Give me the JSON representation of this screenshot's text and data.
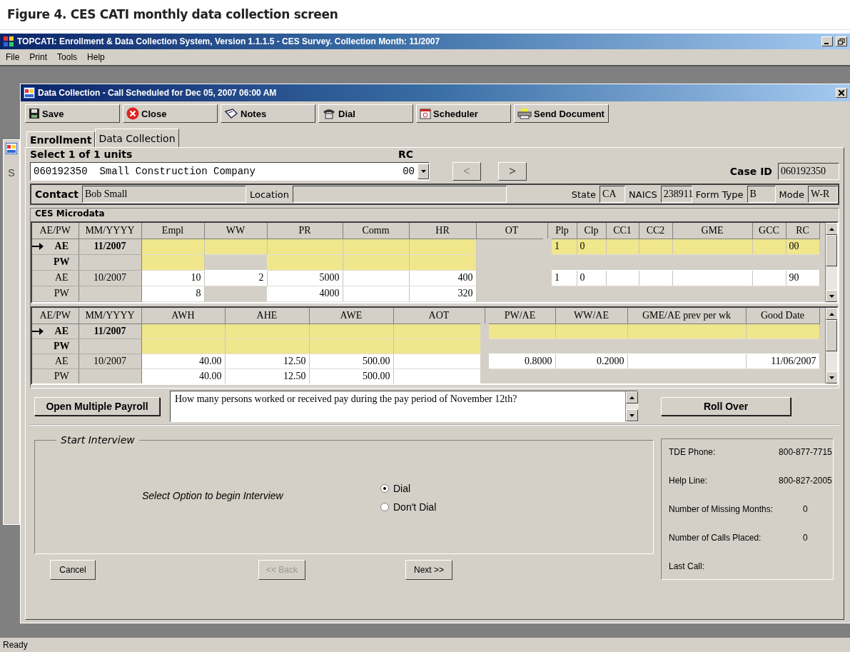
{
  "caption": "Figure 4. CES CATI monthly data collection screen",
  "window": {
    "title": "TOPCATI: Enrollment & Data Collection System, Version 1.1.1.5 - CES Survey. Collection Month: 11/2007"
  },
  "menu": [
    "File",
    "Print",
    "Tools",
    "Help"
  ],
  "background_window": {
    "label": "S"
  },
  "dialog": {
    "title": "Data Collection - Call Scheduled for Dec 05, 2007 06:00 AM"
  },
  "toolbar": [
    {
      "label": "Save",
      "kind": "save"
    },
    {
      "label": "Close",
      "kind": "close"
    },
    {
      "label": "Notes",
      "kind": "notes"
    },
    {
      "label": "Dial",
      "kind": "dial"
    },
    {
      "label": "Scheduler",
      "kind": "scheduler"
    },
    {
      "label": "Send Document",
      "kind": "send"
    }
  ],
  "tabs": [
    {
      "label": "Enrollment",
      "selected": false
    },
    {
      "label": "Data Collection",
      "selected": true
    }
  ],
  "unit": {
    "heading": "Select 1 of 1 units",
    "rc_label": "RC",
    "value": "060192350  Small Construction Company",
    "rc": "00",
    "prev": {
      "label": "<",
      "disabled": true
    },
    "next": {
      "label": ">",
      "disabled": false
    },
    "case_id_label": "Case ID",
    "case_id": "060192350"
  },
  "contact": [
    {
      "label": "Contact",
      "value": "Bob Small"
    },
    {
      "label": "Location"
    },
    {
      "label": "State",
      "value": "CA"
    },
    {
      "label": "NAICS",
      "value": "238911"
    },
    {
      "label": "Form Type",
      "value": "B"
    },
    {
      "label": "Mode",
      "value": "W-R"
    }
  ],
  "microdata": {
    "title": "CES Microdata",
    "grids": [
      {
        "columns": [
          "AE/PW",
          "MM/YYYY",
          "Empl",
          "WW",
          "PR",
          "Comm",
          "HR",
          "OT",
          "Plp",
          "Clp",
          "CC1",
          "CC2",
          "GME",
          "GCC",
          "RC"
        ],
        "rows": [
          {
            "current": true,
            "pointer": true,
            "cells": [
              {
                "kind": "label",
                "value": "AE"
              },
              {
                "kind": "label",
                "value": "11/2007"
              },
              {
                "kind": "entry"
              },
              {
                "kind": "entry"
              },
              {
                "kind": "entry"
              },
              {
                "kind": "entry"
              },
              {
                "kind": "entry"
              },
              {
                "kind": "none"
              },
              {
                "kind": "entry",
                "value": "1"
              },
              {
                "kind": "entry",
                "value": "0"
              },
              {
                "kind": "entry"
              },
              {
                "kind": "entry"
              },
              {
                "kind": "entry"
              },
              {
                "kind": "entry"
              },
              {
                "kind": "entry",
                "value": "00"
              }
            ]
          },
          {
            "current": true,
            "pointer": false,
            "cells": [
              {
                "kind": "label",
                "value": "PW"
              },
              {
                "kind": "label"
              },
              {
                "kind": "entry"
              },
              {
                "kind": "none"
              },
              {
                "kind": "entry"
              },
              {
                "kind": "entry"
              },
              {
                "kind": "entry"
              },
              {
                "kind": "none"
              },
              {
                "kind": "none"
              },
              {
                "kind": "none"
              },
              {
                "kind": "none"
              },
              {
                "kind": "none"
              },
              {
                "kind": "none"
              },
              {
                "kind": "none"
              },
              {
                "kind": "none"
              }
            ]
          },
          {
            "current": false,
            "pointer": false,
            "cells": [
              {
                "kind": "label",
                "value": "AE"
              },
              {
                "kind": "label",
                "value": "10/2007"
              },
              {
                "kind": "value",
                "value": "10"
              },
              {
                "kind": "value",
                "value": "2"
              },
              {
                "kind": "value",
                "value": "5000"
              },
              {
                "kind": "value"
              },
              {
                "kind": "value",
                "value": "400"
              },
              {
                "kind": "none"
              },
              {
                "kind": "value",
                "value": "1"
              },
              {
                "kind": "value",
                "value": "0"
              },
              {
                "kind": "value"
              },
              {
                "kind": "value"
              },
              {
                "kind": "value"
              },
              {
                "kind": "value"
              },
              {
                "kind": "value",
                "value": "90"
              }
            ]
          },
          {
            "current": false,
            "pointer": false,
            "cells": [
              {
                "kind": "label",
                "value": "PW"
              },
              {
                "kind": "label"
              },
              {
                "kind": "value",
                "value": "8"
              },
              {
                "kind": "none"
              },
              {
                "kind": "value",
                "value": "4000"
              },
              {
                "kind": "value"
              },
              {
                "kind": "value",
                "value": "320"
              },
              {
                "kind": "none"
              },
              {
                "kind": "none"
              },
              {
                "kind": "none"
              },
              {
                "kind": "none"
              },
              {
                "kind": "none"
              },
              {
                "kind": "none"
              },
              {
                "kind": "none"
              },
              {
                "kind": "none"
              }
            ]
          }
        ]
      },
      {
        "columns": [
          "AE/PW",
          "MM/YYYY",
          "AWH",
          "AHE",
          "AWE",
          "AOT",
          "PW/AE",
          "WW/AE",
          "GME/AE prev per wk",
          "Good Date"
        ],
        "rows": [
          {
            "current": true,
            "pointer": true,
            "cells": [
              {
                "kind": "label",
                "value": "AE"
              },
              {
                "kind": "label",
                "value": "11/2007"
              },
              {
                "kind": "entry"
              },
              {
                "kind": "entry"
              },
              {
                "kind": "entry"
              },
              {
                "kind": "entry"
              },
              {
                "kind": "entry"
              },
              {
                "kind": "entry"
              },
              {
                "kind": "entry"
              },
              {
                "kind": "entry"
              }
            ]
          },
          {
            "current": true,
            "pointer": false,
            "cells": [
              {
                "kind": "label",
                "value": "PW"
              },
              {
                "kind": "label"
              },
              {
                "kind": "entry"
              },
              {
                "kind": "entry"
              },
              {
                "kind": "entry"
              },
              {
                "kind": "entry"
              },
              {
                "kind": "none"
              },
              {
                "kind": "none"
              },
              {
                "kind": "none"
              },
              {
                "kind": "none"
              }
            ]
          },
          {
            "current": false,
            "pointer": false,
            "cells": [
              {
                "kind": "label",
                "value": "AE"
              },
              {
                "kind": "label",
                "value": "10/2007"
              },
              {
                "kind": "value",
                "value": "40.00"
              },
              {
                "kind": "value",
                "value": "12.50"
              },
              {
                "kind": "value",
                "value": "500.00"
              },
              {
                "kind": "value"
              },
              {
                "kind": "value",
                "value": "0.8000"
              },
              {
                "kind": "value",
                "value": "0.2000"
              },
              {
                "kind": "value"
              },
              {
                "kind": "value",
                "value": "11/06/2007"
              }
            ]
          },
          {
            "current": false,
            "pointer": false,
            "cells": [
              {
                "kind": "label",
                "value": "PW"
              },
              {
                "kind": "label"
              },
              {
                "kind": "value",
                "value": "40.00"
              },
              {
                "kind": "value",
                "value": "12.50"
              },
              {
                "kind": "value",
                "value": "500.00"
              },
              {
                "kind": "value"
              },
              {
                "kind": "none"
              },
              {
                "kind": "none"
              },
              {
                "kind": "none"
              },
              {
                "kind": "none"
              }
            ]
          }
        ]
      }
    ]
  },
  "question": {
    "button": "Open Multiple Payroll",
    "text": "How many persons worked or received pay during the pay period of November 12th?",
    "roll_over": "Roll Over"
  },
  "interview": {
    "legend": "Start Interview",
    "prompt": "Select Option to begin Interview",
    "options": [
      {
        "label": "Dial",
        "selected": true
      },
      {
        "label": "Don't Dial",
        "selected": false
      }
    ]
  },
  "info": [
    {
      "label": "TDE Phone:",
      "value": "800-877-7715"
    },
    {
      "label": "Help Line:",
      "value": "800-827-2005"
    },
    {
      "label": "Number of Missing Months:",
      "value": "0"
    },
    {
      "label": "Number of Calls Placed:",
      "value": "0"
    },
    {
      "label": "Last Call:"
    }
  ],
  "nav": [
    {
      "label": "Cancel",
      "disabled": false
    },
    {
      "label": "<< Back",
      "disabled": true
    },
    {
      "label": "Next >>",
      "disabled": false
    }
  ],
  "status_bar": "Ready"
}
